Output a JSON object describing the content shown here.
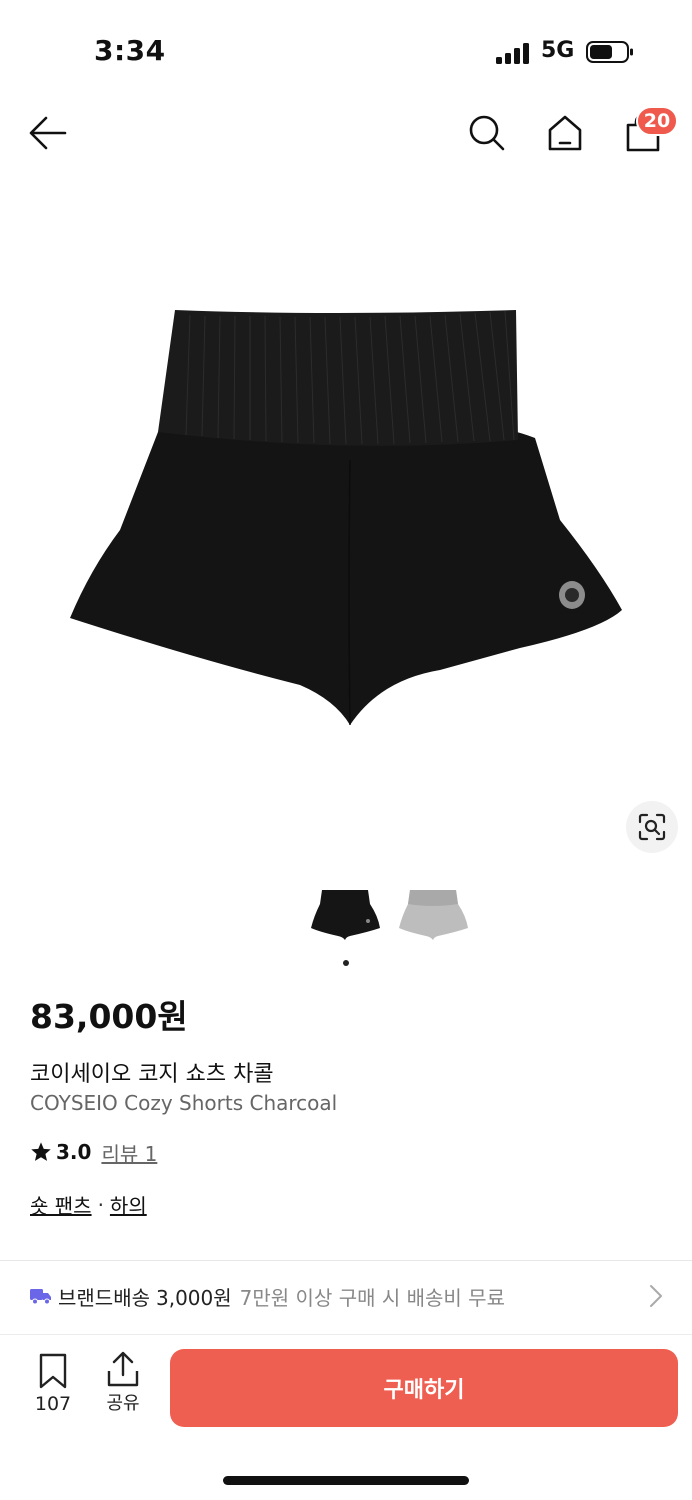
{
  "status_bar": {
    "time": "3:34",
    "network": "5G"
  },
  "header": {
    "cart_count": "20"
  },
  "product": {
    "price": "83,000원",
    "name_ko": "코이세이오 코지 쇼츠 차콜",
    "name_en": "COYSEIO Cozy Shorts Charcoal",
    "rating": "3.0",
    "review_label": "리뷰 1",
    "category": "숏 팬츠",
    "category_separator": "·",
    "parent_category": "하의",
    "image_page": {
      "current": 1,
      "total": 2
    }
  },
  "delivery": {
    "label": "브랜드배송",
    "fee": "3,000원",
    "note": "7만원 이상 구매 시 배송비 무료"
  },
  "bottom_bar": {
    "bookmark_count": "107",
    "share_label": "공유",
    "buy_label": "구매하기"
  },
  "colors": {
    "accent": "#ef5f51",
    "badge": "#ef5a4c",
    "delivery_icon": "#6b66e8"
  },
  "icons": [
    "back-arrow-icon",
    "search-icon",
    "home-icon",
    "shopping-bag-icon",
    "lens-search-icon",
    "star-icon",
    "truck-icon",
    "chevron-right-icon",
    "bookmark-icon",
    "share-icon"
  ]
}
